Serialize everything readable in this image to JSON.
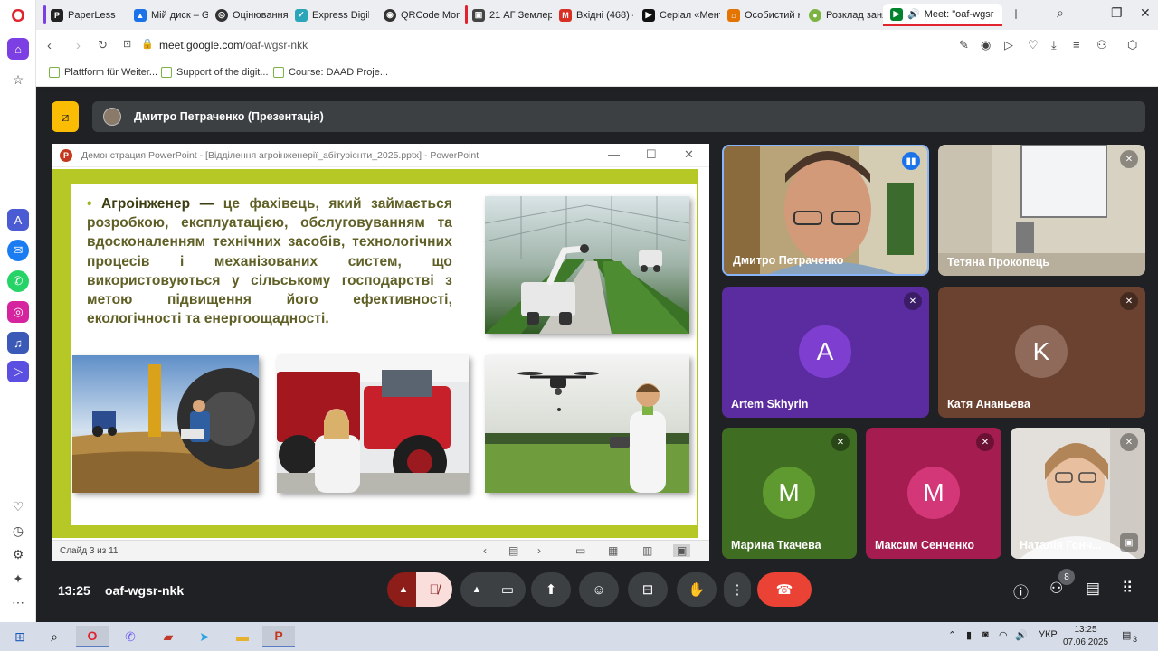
{
  "browser": {
    "tabs": [
      {
        "label": "PaperLess",
        "fav": "Pl",
        "color": "#222"
      },
      {
        "label": "Мій диск – Go",
        "fav": "▲",
        "color": "#1a73e8"
      },
      {
        "label": "Оцінювання в",
        "fav": "◎",
        "color": "#333"
      },
      {
        "label": "Express Digibo",
        "fav": "✓",
        "color": "#2ba5b8"
      },
      {
        "label": "QRCode Monk",
        "fav": "◉",
        "color": "#333"
      },
      {
        "label": "21 АГ Землер",
        "fav": "▣",
        "color": "#444"
      },
      {
        "label": "Вхідні (468) – g",
        "fav": "M",
        "color": "#d93025"
      },
      {
        "label": "Серіал «Мент",
        "fav": "▶",
        "color": "#111"
      },
      {
        "label": "Особистий ка",
        "fav": "⌂",
        "color": "#e37400"
      },
      {
        "label": "Розклад занят",
        "fav": "●",
        "color": "#7cb342"
      },
      {
        "label": "Meet: \"oaf-wgsr",
        "fav": "▶",
        "color": "#00832d"
      }
    ],
    "url_domain": "meet.google.com",
    "url_path": "/oaf-wgsr-nkk",
    "bookmarks": [
      "Plattform für Weiter...",
      "Support of the digit...",
      "Course: DAAD Proje..."
    ]
  },
  "sidebar_icons": [
    "opera-logo",
    "home-icon",
    "star-icon",
    "aria-icon",
    "messenger-icon",
    "whatsapp-icon",
    "instagram-icon",
    "music-icon",
    "player-icon",
    "heart-icon",
    "history-icon",
    "settings-icon",
    "bulb-icon",
    "more-icon"
  ],
  "meet": {
    "presenter_label": "Дмитро Петраченко (Презентація)",
    "meeting_time": "13:25",
    "meeting_code": "oaf-wgsr-nkk",
    "participants_count": "8",
    "accent": "#ea4335"
  },
  "ppt": {
    "window_title": "Демонстрация PowerPoint - [Відділення агроінженерії_абітурієнти_2025.pptx] - PowerPoint",
    "slide_status": "Слайд 3 из 11",
    "slide_bullet": "•",
    "slide_heading": "Агроінженер —",
    "slide_body": "це фахівець, який займається розробкою, експлуатацією, обслуговуванням та вдосконаленням технічних засобів, технологічних процесів і механізованих систем, що використовуються у сільському господарстві з метою підвищення його ефективності, екологічності та енергоощадності."
  },
  "tiles": [
    {
      "name": "Дмитро Петраченко",
      "type": "video",
      "speaking": true
    },
    {
      "name": "Тетяна Прокопець",
      "type": "video",
      "muted": true
    },
    {
      "name": "Artem Skhyrin",
      "letter": "A",
      "bg": "#5b2c9f",
      "circle": "#7e3fd0",
      "muted": true
    },
    {
      "name": "Катя Ананьева",
      "letter": "K",
      "bg": "#6b4130",
      "circle": "#8f6a5a",
      "muted": true
    },
    {
      "name": "Марина Ткачева",
      "letter": "M",
      "bg": "#3f6d22",
      "circle": "#5f9a30",
      "muted": true
    },
    {
      "name": "Максим Сенченко",
      "letter": "M",
      "bg": "#a51d50",
      "circle": "#d33777",
      "muted": true
    },
    {
      "name": "Наталія Гонч...",
      "type": "video",
      "muted": true
    }
  ],
  "taskbar": {
    "lang": "УКР",
    "time": "13:25",
    "date": "07.06.2025",
    "notifications": "3"
  }
}
